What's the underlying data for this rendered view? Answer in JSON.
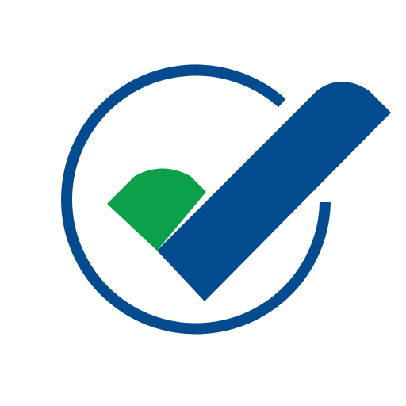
{
  "logo": {
    "icon": "checkmark-in-circle-icon",
    "colors": {
      "ring": "#034b8f",
      "check": "#034b8f",
      "leaf": "#0ba14b",
      "background": "#ffffff"
    }
  }
}
